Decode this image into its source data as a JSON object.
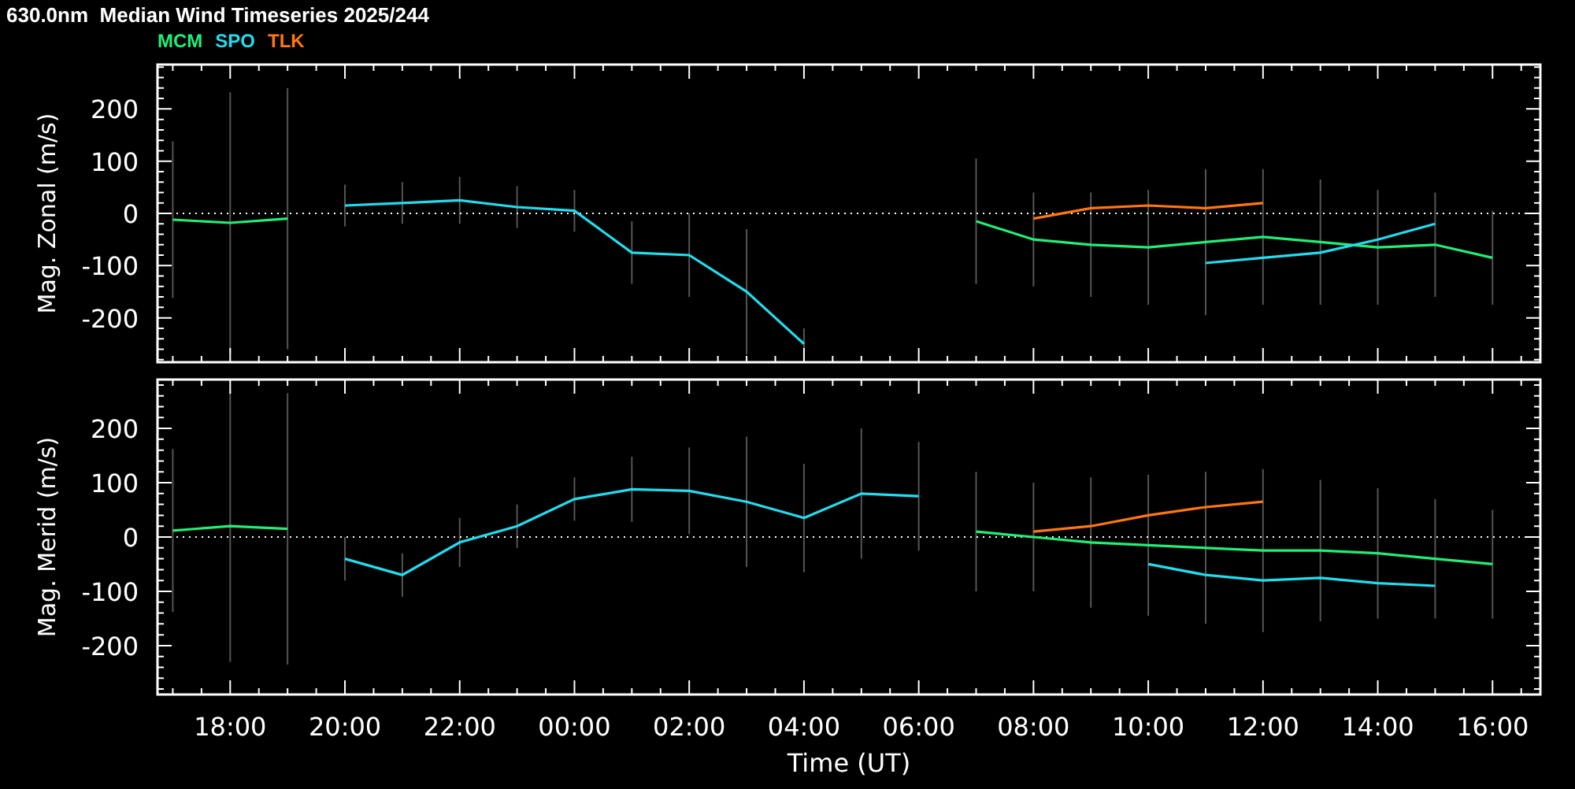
{
  "title": "630.0nm  Median Wind Timeseries 2025/244",
  "charts": [
    {
      "chart_data": {
        "type": "line",
        "ylabel": "Mag. Zonal (m/s)",
        "xlim": [
          "2025-08-31T16:44",
          "2025-09-01T16:50"
        ],
        "ylim": [
          -285,
          285
        ],
        "yticks": [
          -200,
          -100,
          0,
          100,
          200
        ],
        "ref_lines": [
          {
            "axis": "y",
            "value": 0
          }
        ],
        "x": [
          "2025-08-31T17:00",
          "2025-08-31T18:00",
          "2025-08-31T19:00",
          "2025-08-31T20:00",
          "2025-08-31T21:00",
          "2025-08-31T22:00",
          "2025-08-31T23:00",
          "2025-09-01T00:00",
          "2025-09-01T01:00",
          "2025-09-01T02:00",
          "2025-09-01T03:00",
          "2025-09-01T04:00",
          "2025-09-01T05:00",
          "2025-09-01T06:00",
          "2025-09-01T07:00",
          "2025-09-01T08:00",
          "2025-09-01T09:00",
          "2025-09-01T10:00",
          "2025-09-01T11:00",
          "2025-09-01T12:00",
          "2025-09-01T13:00",
          "2025-09-01T14:00",
          "2025-09-01T15:00",
          "2025-09-01T16:00"
        ],
        "series": [
          {
            "name": "MCM",
            "color": "#22ee77",
            "values": [
              -12,
              -18,
              -10,
              null,
              null,
              null,
              null,
              null,
              null,
              null,
              null,
              null,
              null,
              null,
              -15,
              -50,
              -60,
              -65,
              -55,
              -45,
              -55,
              -65,
              -60,
              -85
            ],
            "errors": [
              150,
              250,
              250,
              null,
              null,
              null,
              null,
              null,
              null,
              null,
              null,
              null,
              null,
              null,
              120,
              90,
              100,
              110,
              140,
              130,
              120,
              110,
              100,
              90
            ]
          },
          {
            "name": "SPO",
            "color": "#22ddee",
            "values": [
              null,
              null,
              null,
              15,
              20,
              25,
              12,
              5,
              -75,
              -80,
              -150,
              -250,
              null,
              null,
              null,
              null,
              null,
              null,
              -95,
              -85,
              -75,
              -50,
              -20,
              null
            ],
            "errors": [
              null,
              null,
              null,
              40,
              40,
              45,
              40,
              40,
              60,
              80,
              120,
              30,
              null,
              null,
              null,
              null,
              null,
              null,
              null,
              null,
              null,
              null,
              null,
              null
            ]
          },
          {
            "name": "TLK",
            "color": "#ff7711",
            "values": [
              null,
              null,
              null,
              null,
              null,
              null,
              null,
              null,
              null,
              null,
              null,
              null,
              null,
              null,
              null,
              -10,
              10,
              15,
              10,
              20,
              null,
              null,
              null,
              null
            ]
          }
        ]
      }
    },
    {
      "chart_data": {
        "type": "line",
        "ylabel": "Mag. Merid (m/s)",
        "xlabel": "Time (UT)",
        "xlim": [
          "2025-08-31T16:44",
          "2025-09-01T16:50"
        ],
        "ylim": [
          -290,
          290
        ],
        "yticks": [
          -200,
          -100,
          0,
          100,
          200
        ],
        "ref_lines": [
          {
            "axis": "y",
            "value": 0
          }
        ],
        "xticks": [
          {
            "value": "2025-08-31T18:00",
            "label": "18:00"
          },
          {
            "value": "2025-08-31T20:00",
            "label": "20:00"
          },
          {
            "value": "2025-08-31T22:00",
            "label": "22:00"
          },
          {
            "value": "2025-09-01T00:00",
            "label": "00:00"
          },
          {
            "value": "2025-09-01T02:00",
            "label": "02:00"
          },
          {
            "value": "2025-09-01T04:00",
            "label": "04:00"
          },
          {
            "value": "2025-09-01T06:00",
            "label": "06:00"
          },
          {
            "value": "2025-09-01T08:00",
            "label": "08:00"
          },
          {
            "value": "2025-09-01T10:00",
            "label": "10:00"
          },
          {
            "value": "2025-09-01T12:00",
            "label": "12:00"
          },
          {
            "value": "2025-09-01T14:00",
            "label": "14:00"
          },
          {
            "value": "2025-09-01T16:00",
            "label": "16:00"
          }
        ],
        "x": [
          "2025-08-31T17:00",
          "2025-08-31T18:00",
          "2025-08-31T19:00",
          "2025-08-31T20:00",
          "2025-08-31T21:00",
          "2025-08-31T22:00",
          "2025-08-31T23:00",
          "2025-09-01T00:00",
          "2025-09-01T01:00",
          "2025-09-01T02:00",
          "2025-09-01T03:00",
          "2025-09-01T04:00",
          "2025-09-01T05:00",
          "2025-09-01T06:00",
          "2025-09-01T07:00",
          "2025-09-01T08:00",
          "2025-09-01T09:00",
          "2025-09-01T10:00",
          "2025-09-01T11:00",
          "2025-09-01T12:00",
          "2025-09-01T13:00",
          "2025-09-01T14:00",
          "2025-09-01T15:00",
          "2025-09-01T16:00"
        ],
        "series": [
          {
            "color": "#22ee77",
            "values": [
              12,
              20,
              15,
              null,
              null,
              null,
              null,
              null,
              null,
              null,
              null,
              null,
              null,
              null,
              10,
              0,
              -10,
              -15,
              -20,
              -25,
              -25,
              -30,
              -40,
              -50
            ],
            "errors": [
              150,
              250,
              250,
              null,
              null,
              null,
              null,
              null,
              null,
              null,
              null,
              null,
              null,
              null,
              110,
              100,
              120,
              130,
              140,
              150,
              130,
              120,
              110,
              100
            ]
          },
          {
            "color": "#22ddee",
            "values": [
              null,
              null,
              null,
              -40,
              -70,
              -10,
              20,
              70,
              88,
              85,
              65,
              35,
              80,
              75,
              null,
              null,
              null,
              -50,
              -70,
              -80,
              -75,
              -85,
              -90,
              null
            ],
            "errors": [
              null,
              null,
              null,
              40,
              40,
              45,
              40,
              40,
              60,
              80,
              120,
              100,
              120,
              100,
              null,
              null,
              null,
              null,
              null,
              null,
              null,
              null,
              null,
              null
            ]
          },
          {
            "color": "#ff7711",
            "values": [
              null,
              null,
              null,
              null,
              null,
              null,
              null,
              null,
              null,
              null,
              null,
              null,
              null,
              null,
              null,
              10,
              20,
              40,
              55,
              65,
              null,
              null,
              null,
              null
            ]
          }
        ]
      }
    }
  ]
}
